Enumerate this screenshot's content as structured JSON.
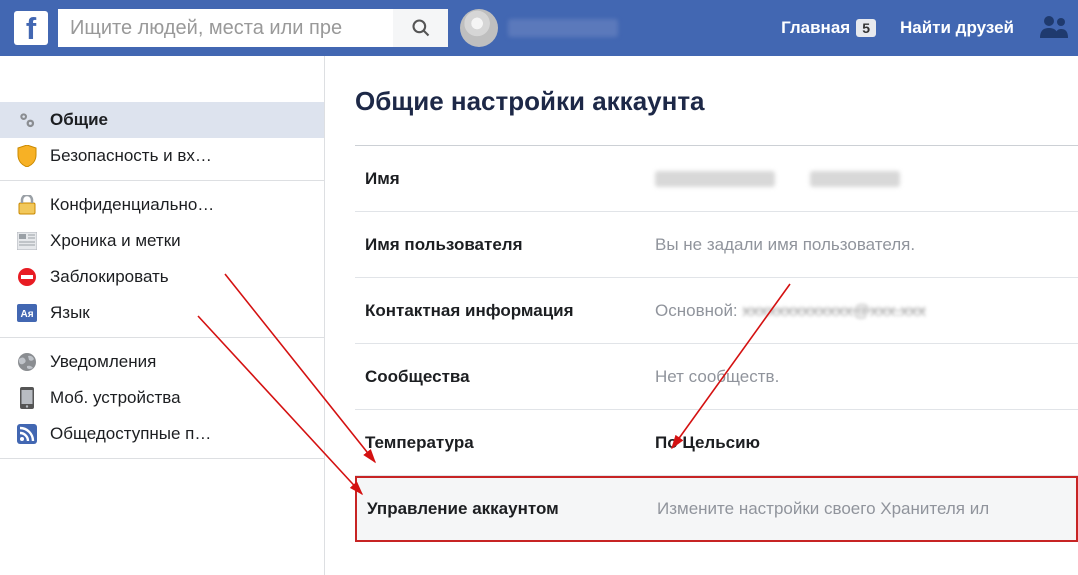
{
  "header": {
    "search_placeholder": "Ищите людей, места или пре",
    "home_label": "Главная",
    "home_badge": "5",
    "find_friends_label": "Найти друзей"
  },
  "sidebar": {
    "groups": [
      {
        "items": [
          {
            "key": "general",
            "label": "Общие",
            "icon": "gear",
            "active": true
          },
          {
            "key": "security",
            "label": "Безопасность и вх…",
            "icon": "shield"
          }
        ]
      },
      {
        "items": [
          {
            "key": "privacy",
            "label": "Конфиденциально…",
            "icon": "lock"
          },
          {
            "key": "timeline",
            "label": "Хроника и метки",
            "icon": "newspaper"
          },
          {
            "key": "blocking",
            "label": "Заблокировать",
            "icon": "block"
          },
          {
            "key": "language",
            "label": "Язык",
            "icon": "language"
          }
        ]
      },
      {
        "items": [
          {
            "key": "notifications",
            "label": "Уведомления",
            "icon": "globe"
          },
          {
            "key": "mobile",
            "label": "Моб. устройства",
            "icon": "mobile"
          },
          {
            "key": "public",
            "label": "Общедоступные п…",
            "icon": "rss"
          }
        ]
      }
    ]
  },
  "main": {
    "title": "Общие настройки аккаунта",
    "rows": [
      {
        "key": "name",
        "label": "Имя",
        "value_type": "blur"
      },
      {
        "key": "username",
        "label": "Имя пользователя",
        "value": "Вы не задали имя пользователя."
      },
      {
        "key": "contact",
        "label": "Контактная информация",
        "prefix": "Основной: ",
        "value_type": "strike"
      },
      {
        "key": "networks",
        "label": "Сообщества",
        "value": "Нет сообществ."
      },
      {
        "key": "temperature",
        "label": "Температура",
        "value": "По Цельсию",
        "strong": true
      },
      {
        "key": "manage",
        "label": "Управление аккаунтом",
        "value": "Измените настройки своего Хранителя ил",
        "highlight": true
      }
    ]
  }
}
